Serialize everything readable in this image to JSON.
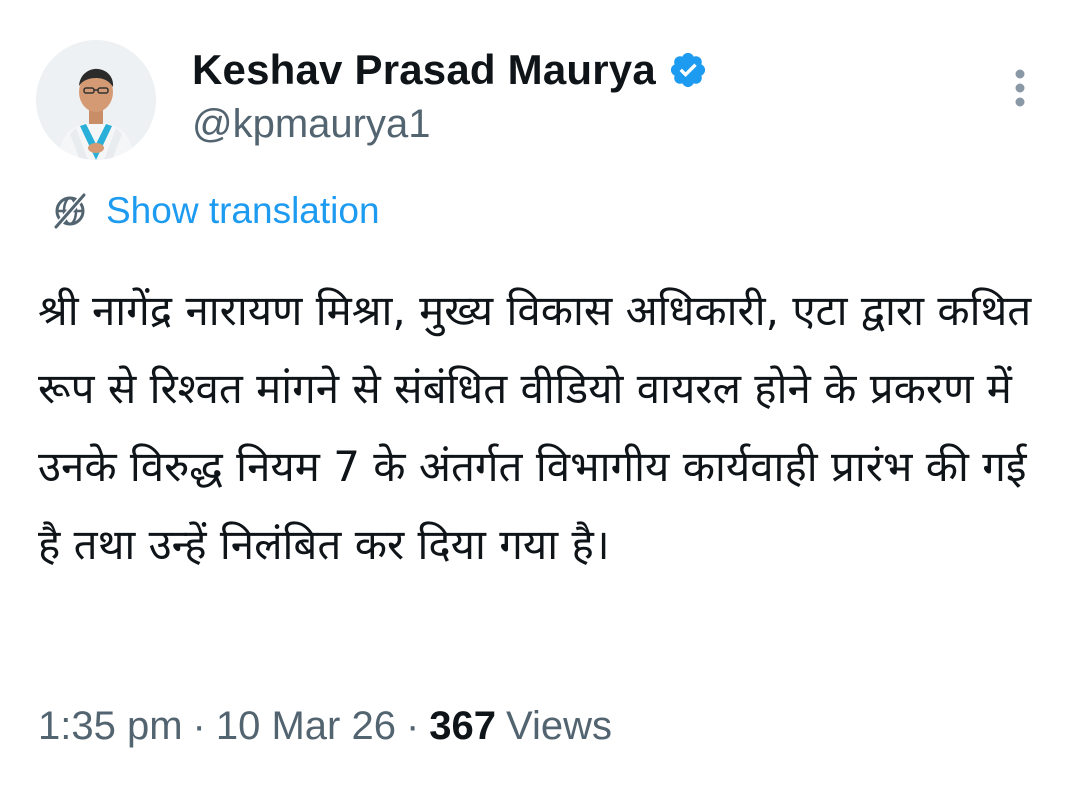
{
  "author": {
    "display_name": "Keshav Prasad Maurya",
    "handle": "@kpmaurya1",
    "verified": true,
    "avatar_icon": "profile-photo",
    "verified_icon": "verified-badge-icon"
  },
  "actions": {
    "more_icon": "more-vertical-icon"
  },
  "translation": {
    "label": "Show translation",
    "icon": "globe-slash-icon"
  },
  "tweet": {
    "text": "श्री नागेंद्र नारायण मिश्रा, मुख्य विकास अधिकारी, एटा द्वारा कथित रूप से रिश्वत मांगने से संबंधित वीडियो वायरल होने के प्रकरण में उनके विरुद्ध नियम 7 के अंतर्गत विभागीय कार्यवाही प्रारंभ की गई है तथा उन्हें निलंबित कर दिया गया है।"
  },
  "meta": {
    "time": "1:35 pm",
    "separator": "·",
    "date": "10 Mar 26",
    "views_count": "367",
    "views_label": "Views"
  },
  "colors": {
    "accent": "#1d9bf0",
    "text_primary": "#0f1419",
    "text_secondary": "#536471",
    "background": "#ffffff"
  }
}
